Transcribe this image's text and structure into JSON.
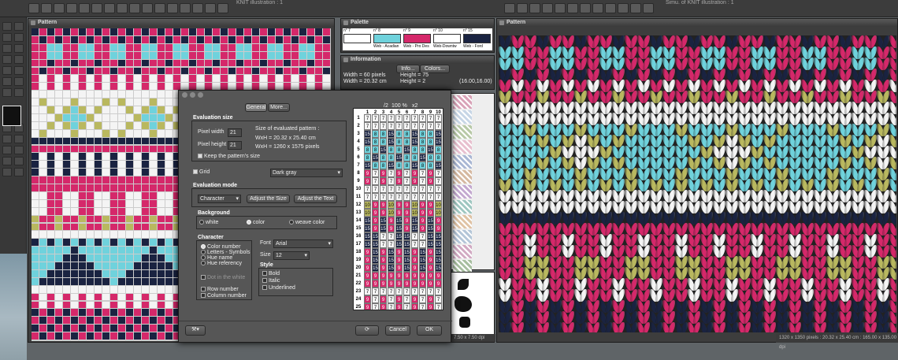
{
  "windows": {
    "left_title": "KNIT illustration : 1",
    "right_title": "Simu. of KNIT illustration : 1"
  },
  "pattern_panel": {
    "title": "Pattern"
  },
  "palette_panel": {
    "title": "Palette",
    "swatches": [
      {
        "num": "n° 7",
        "name": "",
        "color": "#ffffff"
      },
      {
        "num": "n° 8",
        "name": "Web - Acadian",
        "color": "#6fd2dc"
      },
      {
        "num": "n° 9",
        "name": "Web - Pro Des",
        "color": "#d5286a"
      },
      {
        "num": "n° 10",
        "name": "Web-Downtw",
        "color": "#ffffff"
      },
      {
        "num": "n° 15",
        "name": "Web - Ford",
        "color": "#1a2341"
      }
    ]
  },
  "info_panel": {
    "title": "Information",
    "tab_info": "Info...",
    "tab_colors": "Colors...",
    "width_px": "Width =   60   pixels",
    "width_cm": "Width =   20.32 cm",
    "height_px": "Height =  75",
    "height_mult": "Height =  2",
    "coords": "(16.00,16.00)"
  },
  "dialog": {
    "tab_general": "General",
    "tab_more": "More...",
    "eval_size_title": "Evaluation size",
    "pixel_width_label": "Pixel width",
    "pixel_width_value": "21",
    "pixel_height_label": "Pixel height",
    "pixel_height_value": "21",
    "size_title": "Size of evaluated pattern :",
    "size_cm": "WxH = 20.32 x 25.40 cm",
    "size_px": "WxH = 1260 x 1575 pixels",
    "keep_size": "Keep the pattern's size",
    "grid_label": "Grid",
    "grid_color": "Dark gray",
    "eval_mode_title": "Evaluation mode",
    "mode_value": "Character",
    "adjust_size": "Adjust the Size",
    "adjust_text": "Adjust the Text",
    "background_title": "Background",
    "bg_white": "white",
    "bg_color": "color",
    "bg_weave": "weave color",
    "character_title": "Character",
    "char_options": [
      "Color number",
      "Letters - Symbols",
      "Hue name",
      "Hue referency"
    ],
    "dot_white": "Dot in the white",
    "row_number": "Row number",
    "column_number": "Column number",
    "font_label": "Font",
    "font_value": "Arial",
    "size_label": "Size",
    "size_value": "12",
    "style_title": "Style",
    "style_options": [
      "Bold",
      "Italic",
      "Underlined"
    ],
    "cancel": "Cancel",
    "ok": "OK"
  },
  "preview": {
    "zoom_out": "/2",
    "zoom": "100 %",
    "zoom_in": "x2",
    "columns": [
      "1",
      "2",
      "3",
      "4",
      "5",
      "6",
      "7",
      "8",
      "9",
      "10"
    ],
    "rows": [
      "1",
      "2",
      "3",
      "4",
      "5",
      "6",
      "7",
      "8",
      "9",
      "10",
      "11",
      "12",
      "13",
      "14",
      "15",
      "16",
      "17",
      "18",
      "19",
      "20",
      "21",
      "22",
      "23",
      "24",
      "25"
    ]
  },
  "shapes_status": "7.50 x 7.50 dpi",
  "status_bar": "1320 x 1350 pixels : 20.32 x 25.40 cm : 165.00 x 135.00 dpi",
  "colors": {
    "navy": "#1a2341",
    "cyan": "#6fd2dc",
    "magenta": "#d5286a",
    "olive": "#b9b85f",
    "white": "#f4f4f4"
  }
}
